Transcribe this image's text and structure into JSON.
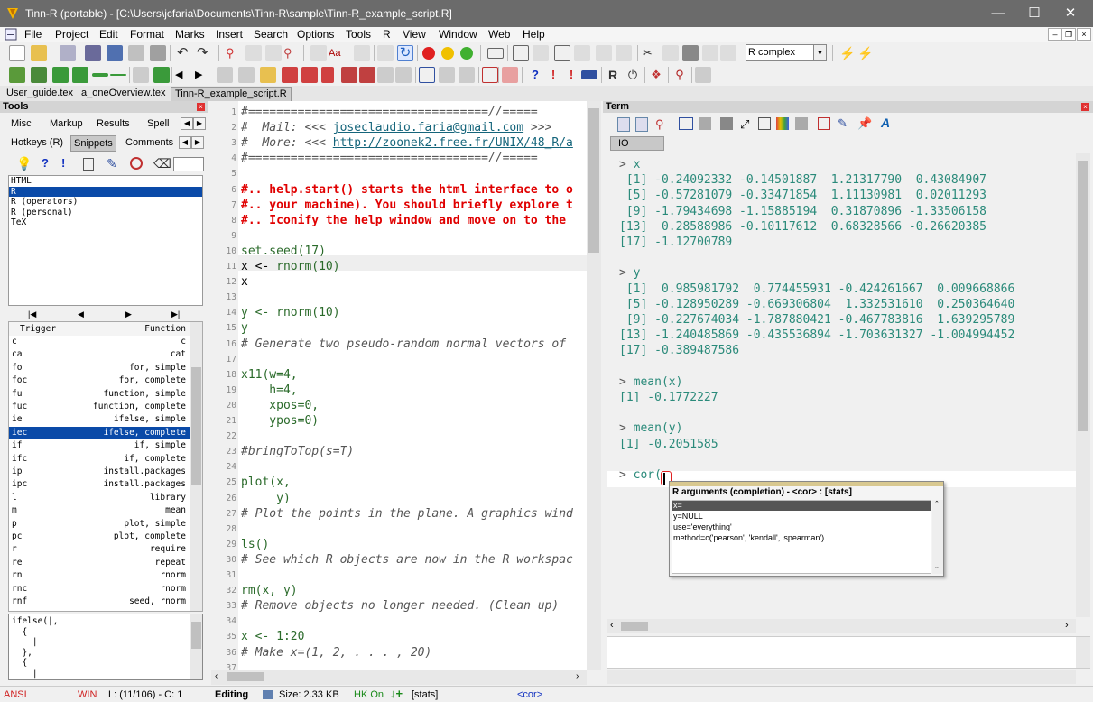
{
  "window": {
    "title": "Tinn-R (portable) - [C:\\Users\\jcfaria\\Documents\\Tinn-R\\sample\\Tinn-R_example_script.R]",
    "minimize": "—",
    "maximize": "☐",
    "close": "✕"
  },
  "menu": [
    "File",
    "Project",
    "Edit",
    "Format",
    "Marks",
    "Insert",
    "Search",
    "Options",
    "Tools",
    "R",
    "View",
    "Window",
    "Web",
    "Help"
  ],
  "toolbar": {
    "combo_value": "R complex"
  },
  "tabs": [
    "User_guide.tex",
    "a_oneOverview.tex",
    "Tinn-R_example_script.R"
  ],
  "tools_panel": {
    "title": "Tools",
    "tabs1": [
      "Misc",
      "Markup",
      "Results",
      "Spell"
    ],
    "tabs2": [
      "Hotkeys (R)",
      "Snippets",
      "Comments"
    ],
    "languages": [
      "HTML",
      "R",
      "R (operators)",
      "R (personal)",
      "TeX"
    ],
    "selected_language": "R",
    "nav": [
      "|◀",
      "◀",
      "▶",
      "▶|"
    ],
    "col_trigger": "Trigger",
    "col_function": "Function",
    "snippets": [
      [
        "c",
        "c"
      ],
      [
        "ca",
        "cat"
      ],
      [
        "fo",
        "for, simple"
      ],
      [
        "foc",
        "for, complete"
      ],
      [
        "fu",
        "function, simple"
      ],
      [
        "fuc",
        "function, complete"
      ],
      [
        "ie",
        "ifelse, simple"
      ],
      [
        "iec",
        "ifelse, complete"
      ],
      [
        "if",
        "if, simple"
      ],
      [
        "ifc",
        "if, complete"
      ],
      [
        "ip",
        "install.packages"
      ],
      [
        "ipc",
        "install.packages"
      ],
      [
        "l",
        "library"
      ],
      [
        "m",
        "mean"
      ],
      [
        "p",
        "plot, simple"
      ],
      [
        "pc",
        "plot, complete"
      ],
      [
        "r",
        "require"
      ],
      [
        "re",
        "repeat"
      ],
      [
        "rn",
        "rnorm"
      ],
      [
        "rnc",
        "rnorm"
      ],
      [
        "rnf",
        "seed, rnorm"
      ]
    ],
    "selected_snippet": "iec",
    "preview": [
      "ifelse(|,",
      "  {",
      "    |",
      "  },",
      "  {",
      "    |"
    ]
  },
  "editor": {
    "lines": [
      {
        "n": "1",
        "html": "<span class='cm'>#==================================//=====</span>"
      },
      {
        "n": "2",
        "html": "<span class='cm'>#  Mail: &lt;&lt;&lt; </span><span class='link'>joseclaudio.faria@gmail.com</span><span class='cm'> &gt;&gt;&gt;</span>"
      },
      {
        "n": "3",
        "html": "<span class='cm'>#  More: &lt;&lt;&lt; </span><span class='link'>http://zoonek2.free.fr/UNIX/48_R/a</span>"
      },
      {
        "n": "4",
        "html": "<span class='cm'>#==================================//=====</span>"
      },
      {
        "n": "5",
        "html": ""
      },
      {
        "n": "6",
        "html": "<span class='red'>#.. help.start() starts the html interface to o</span>"
      },
      {
        "n": "7",
        "html": "<span class='red'>#.. your machine). You should briefly explore t</span>"
      },
      {
        "n": "8",
        "html": "<span class='red'>#.. Iconify the help window and move on to the </span>"
      },
      {
        "n": "9",
        "html": ""
      },
      {
        "n": "10",
        "html": "<span class='cn'>set.seed(17)</span>"
      },
      {
        "n": "11",
        "html": "x &lt;- <span class='cn'>rnorm(10)</span>"
      },
      {
        "n": "12",
        "html": "x"
      },
      {
        "n": "13",
        "html": ""
      },
      {
        "n": "14",
        "html": "<span class='cn'>y &lt;- rnorm(10)</span>"
      },
      {
        "n": "15",
        "html": "<span class='cn'>y</span>"
      },
      {
        "n": "16",
        "html": "<span class='cm'># Generate two pseudo-random normal vectors of</span>"
      },
      {
        "n": "17",
        "html": ""
      },
      {
        "n": "18",
        "html": "<span class='cn'>x11(w=4,</span>"
      },
      {
        "n": "19",
        "html": "<span class='cn'>    h=4,</span>"
      },
      {
        "n": "20",
        "html": "<span class='cn'>    xpos=0,</span>"
      },
      {
        "n": "21",
        "html": "<span class='cn'>    ypos=0)</span>"
      },
      {
        "n": "22",
        "html": ""
      },
      {
        "n": "23",
        "html": "<span class='cm'>#bringToTop(s=T)</span>"
      },
      {
        "n": "24",
        "html": ""
      },
      {
        "n": "25",
        "html": "<span class='cn'>plot(x,</span>"
      },
      {
        "n": "26",
        "html": "<span class='cn'>     y)</span>"
      },
      {
        "n": "27",
        "html": "<span class='cm'># Plot the points in the plane. A graphics wind</span>"
      },
      {
        "n": "28",
        "html": ""
      },
      {
        "n": "29",
        "html": "<span class='cn'>ls()</span>"
      },
      {
        "n": "30",
        "html": "<span class='cm'># See which R objects are now in the R workspac</span>"
      },
      {
        "n": "31",
        "html": ""
      },
      {
        "n": "32",
        "html": "<span class='cn'>rm(x, y)</span>"
      },
      {
        "n": "33",
        "html": "<span class='cm'># Remove objects no longer needed. (Clean up)</span>"
      },
      {
        "n": "34",
        "html": ""
      },
      {
        "n": "35",
        "html": "<span class='cn'>x &lt;- 1:20</span>"
      },
      {
        "n": "36",
        "html": "<span class='cm'># Make x=(1, 2, . . . , 20)</span>"
      },
      {
        "n": "37",
        "html": ""
      }
    ]
  },
  "term": {
    "title": "Term",
    "tab": "IO",
    "lines": [
      "> x",
      " [1] -0.24092332 -0.14501887  1.21317790  0.43084907",
      " [5] -0.57281079 -0.33471854  1.11130981  0.02011293",
      " [9] -1.79434698 -1.15885194  0.31870896 -1.33506158",
      "[13]  0.28588986 -0.10117612  0.68328566 -0.26620385",
      "[17] -1.12700789",
      "",
      "> y",
      " [1]  0.985981792  0.774455931 -0.424261667  0.009668866",
      " [5] -0.128950289 -0.669306804  1.332531610  0.250364640",
      " [9] -0.227674034 -1.787880421 -0.467783816  1.639295789",
      "[13] -1.240485869 -0.435536894 -1.703631327 -1.004994452",
      "[17] -0.389487586",
      "",
      "> mean(x)",
      "[1] -0.1772227",
      "",
      "> mean(y)",
      "[1] -0.2051585",
      "",
      "> cor("
    ],
    "popup": {
      "title": "R arguments (completion) - <cor> : [stats]",
      "items": [
        "x=",
        "y=NULL",
        "use='everything'",
        "method=c('pearson', 'kendall', 'spearman')"
      ]
    }
  },
  "status": {
    "encoding": "ANSI",
    "eol": "WIN",
    "position": "L: (11/106) - C: 1",
    "mode": "Editing",
    "size": "Size: 2.33 KB",
    "hk": "HK On",
    "pkg": "[stats]",
    "func": "<cor>"
  },
  "colors": {
    "accent": "#0a4aa8",
    "titlebar": "#6b6b6b",
    "red_comment": "#e00000",
    "term_text": "#2a8a7a"
  }
}
